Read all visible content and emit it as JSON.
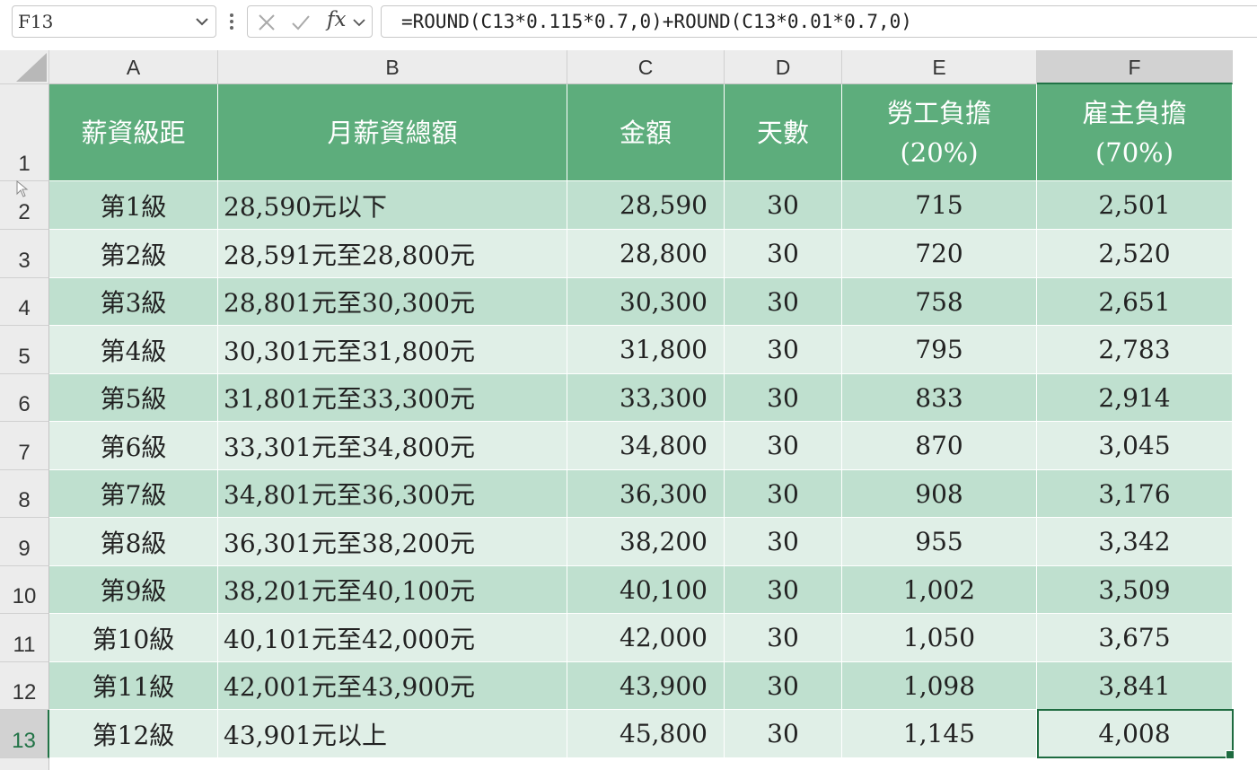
{
  "name_box": {
    "value": "F13"
  },
  "formula_bar": {
    "formula": "=ROUND(C13*0.115*0.7,0)+ROUND(C13*0.01*0.7,0)",
    "fx_label": "fx"
  },
  "columns": [
    "A",
    "B",
    "C",
    "D",
    "E",
    "F"
  ],
  "selected_cell": {
    "column": "F",
    "row": 13
  },
  "headers": {
    "a": "薪資級距",
    "b": "月薪資總額",
    "c": "金額",
    "d": "天數",
    "e_line1": "勞工負擔",
    "e_line2": "(20%)",
    "f_line1": "雇主負擔",
    "f_line2": "(70%)"
  },
  "rows": [
    {
      "num": "1"
    },
    {
      "num": "2",
      "a": "第1級",
      "b": "28,590元以下",
      "c": "28,590",
      "d": "30",
      "e": "715",
      "f": "2,501"
    },
    {
      "num": "3",
      "a": "第2級",
      "b": "28,591元至28,800元",
      "c": "28,800",
      "d": "30",
      "e": "720",
      "f": "2,520"
    },
    {
      "num": "4",
      "a": "第3級",
      "b": "28,801元至30,300元",
      "c": "30,300",
      "d": "30",
      "e": "758",
      "f": "2,651"
    },
    {
      "num": "5",
      "a": "第4級",
      "b": "30,301元至31,800元",
      "c": "31,800",
      "d": "30",
      "e": "795",
      "f": "2,783"
    },
    {
      "num": "6",
      "a": "第5級",
      "b": "31,801元至33,300元",
      "c": "33,300",
      "d": "30",
      "e": "833",
      "f": "2,914"
    },
    {
      "num": "7",
      "a": "第6級",
      "b": "33,301元至34,800元",
      "c": "34,800",
      "d": "30",
      "e": "870",
      "f": "3,045"
    },
    {
      "num": "8",
      "a": "第7級",
      "b": "34,801元至36,300元",
      "c": "36,300",
      "d": "30",
      "e": "908",
      "f": "3,176"
    },
    {
      "num": "9",
      "a": "第8級",
      "b": "36,301元至38,200元",
      "c": "38,200",
      "d": "30",
      "e": "955",
      "f": "3,342"
    },
    {
      "num": "10",
      "a": "第9級",
      "b": "38,201元至40,100元",
      "c": "40,100",
      "d": "30",
      "e": "1,002",
      "f": "3,509"
    },
    {
      "num": "11",
      "a": "第10級",
      "b": "40,101元至42,000元",
      "c": "42,000",
      "d": "30",
      "e": "1,050",
      "f": "3,675"
    },
    {
      "num": "12",
      "a": "第11級",
      "b": "42,001元至43,900元",
      "c": "43,900",
      "d": "30",
      "e": "1,098",
      "f": "3,841"
    },
    {
      "num": "13",
      "a": "第12級",
      "b": "43,901元以上",
      "c": "45,800",
      "d": "30",
      "e": "1,145",
      "f": "4,008"
    }
  ],
  "colors": {
    "header_fill": "#5dad7c",
    "band_dark": "#bfe0cf",
    "band_light": "#e0efe7",
    "accent": "#217346"
  }
}
